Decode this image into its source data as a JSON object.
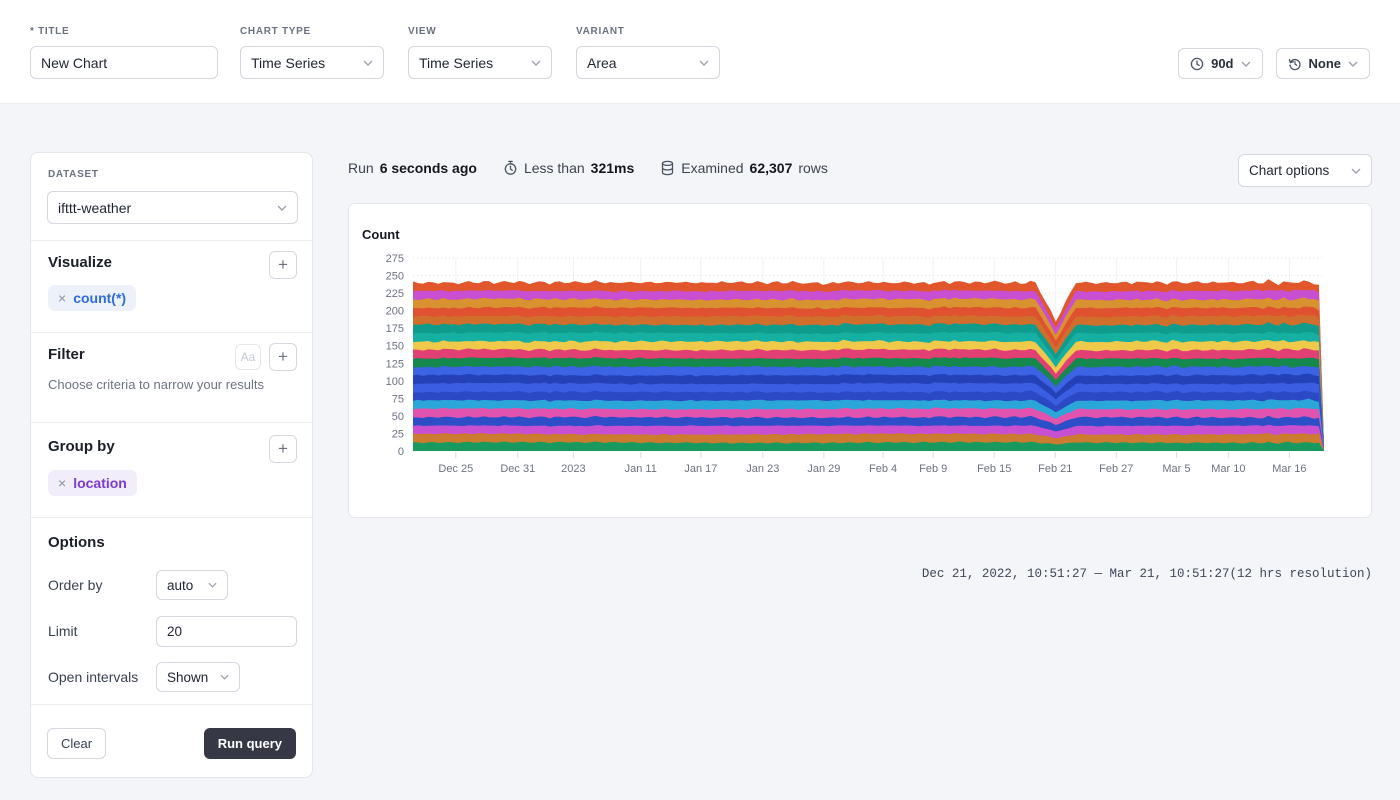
{
  "header": {
    "title_label": "* Title",
    "title_value": "New Chart",
    "chart_type_label": "Chart type",
    "chart_type_value": "Time Series",
    "view_label": "View",
    "view_value": "Time Series",
    "variant_label": "Variant",
    "variant_value": "Area",
    "time_range_value": "90d",
    "compare_value": "None"
  },
  "sidebar": {
    "dataset_label": "Dataset",
    "dataset_value": "ifttt-weather",
    "visualize": {
      "heading": "Visualize",
      "pill": "count(*)",
      "remove": "×",
      "add": "+"
    },
    "filter": {
      "heading": "Filter",
      "aa_label": "Aa",
      "add": "+",
      "hint": "Choose criteria to narrow your results"
    },
    "group_by": {
      "heading": "Group by",
      "pill": "location",
      "remove": "×",
      "add": "+"
    },
    "options": {
      "heading": "Options",
      "order_by_label": "Order by",
      "order_by_value": "auto",
      "limit_label": "Limit",
      "limit_value": "20",
      "open_intervals_label": "Open intervals",
      "open_intervals_value": "Shown"
    },
    "clear_label": "Clear",
    "run_label": "Run query"
  },
  "status": {
    "run_prefix": "Run",
    "run_ago": "6 seconds ago",
    "duration_prefix": "Less than",
    "duration": "321ms",
    "examined_prefix": "Examined",
    "rows_count": "62,307",
    "rows_suffix": "rows",
    "chart_options_label": "Chart options"
  },
  "footer_range": "Dec 21, 2022, 10:51:27 — Mar 21, 10:51:27(12 hrs resolution)",
  "chart_data": {
    "type": "area",
    "stacked": true,
    "title": "Count",
    "ylabel": "Count",
    "ylim": [
      0,
      275
    ],
    "y_ticks": [
      0,
      25,
      50,
      75,
      100,
      125,
      150,
      175,
      200,
      225,
      250,
      275
    ],
    "x_range": [
      "Dec 21, 2022, 10:51:27",
      "Mar 21, 10:51:27"
    ],
    "resolution": "12 hrs",
    "points": 180,
    "x_ticks": [
      {
        "label": "Dec 25",
        "f": 0.047
      },
      {
        "label": "Dec 31",
        "f": 0.115
      },
      {
        "label": "2023",
        "f": 0.176
      },
      {
        "label": "Jan 11",
        "f": 0.25
      },
      {
        "label": "Jan 17",
        "f": 0.316
      },
      {
        "label": "Jan 23",
        "f": 0.384
      },
      {
        "label": "Jan 29",
        "f": 0.451
      },
      {
        "label": "Feb 4",
        "f": 0.516
      },
      {
        "label": "Feb 9",
        "f": 0.571
      },
      {
        "label": "Feb 15",
        "f": 0.638
      },
      {
        "label": "Feb 21",
        "f": 0.705
      },
      {
        "label": "Feb 27",
        "f": 0.772
      },
      {
        "label": "Mar 5",
        "f": 0.838
      },
      {
        "label": "Mar 10",
        "f": 0.895
      },
      {
        "label": "Mar 16",
        "f": 0.962
      }
    ],
    "legend": "none",
    "grid": {
      "horizontal": "dotted",
      "vertical": "faint"
    },
    "total_avg": 240,
    "series_note": "20 stacked location groups, each ~12 events per 12h bucket; bottom-to-top order",
    "series": [
      {
        "color": "#17995f",
        "avg": 12,
        "amp": 1.0
      },
      {
        "color": "#cc7c2e",
        "avg": 12,
        "amp": 1.1
      },
      {
        "color": "#c84fd1",
        "avg": 12,
        "amp": 1.0
      },
      {
        "color": "#2c4fc8",
        "avg": 12,
        "amp": 1.1
      },
      {
        "color": "#e053ae",
        "avg": 12,
        "amp": 1.2
      },
      {
        "color": "#2aa6d8",
        "avg": 12,
        "amp": 1.1
      },
      {
        "color": "#2b49c4",
        "avg": 12,
        "amp": 1.0
      },
      {
        "color": "#3a5de2",
        "avg": 12,
        "amp": 1.1
      },
      {
        "color": "#2441b8",
        "avg": 12,
        "amp": 1.0
      },
      {
        "color": "#3c63e4",
        "avg": 12,
        "amp": 1.1
      },
      {
        "color": "#15884e",
        "avg": 12,
        "amp": 1.0
      },
      {
        "color": "#e23f74",
        "avg": 12,
        "amp": 1.2
      },
      {
        "color": "#eec94a",
        "avg": 12,
        "amp": 1.3
      },
      {
        "color": "#16b0a2",
        "avg": 12,
        "amp": 1.1
      },
      {
        "color": "#0f9c8d",
        "avg": 12,
        "amp": 1.0
      },
      {
        "color": "#d06e2b",
        "avg": 12,
        "amp": 1.1
      },
      {
        "color": "#e0512f",
        "avg": 12,
        "amp": 1.2
      },
      {
        "color": "#d8922f",
        "avg": 12,
        "amp": 1.2
      },
      {
        "color": "#c84fd1",
        "avg": 12,
        "amp": 1.3
      },
      {
        "color": "#e2562b",
        "avg": 12,
        "amp": 2.4
      }
    ],
    "events": {
      "dip": {
        "x_fraction": 0.705,
        "depth": 0.23,
        "width_points": 4
      },
      "noisy_tail_from_fraction": 0.92,
      "end_drop_to_zero": true
    }
  }
}
